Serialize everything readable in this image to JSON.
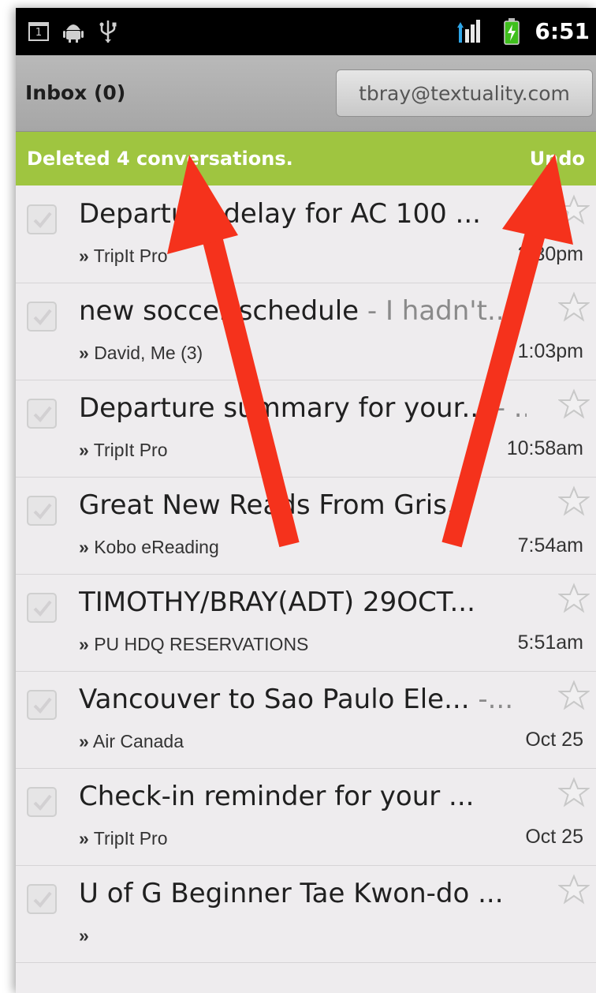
{
  "status_bar": {
    "time": "6:51",
    "calendar_day": "1",
    "icons": [
      "calendar-icon",
      "android-debug-icon",
      "usb-icon",
      "signal-icon",
      "battery-icon"
    ]
  },
  "header": {
    "title": "Inbox (0)",
    "account": "tbray@textuality.com"
  },
  "undo_bar": {
    "message": "Deleted 4 conversations.",
    "undo_label": "Undo",
    "color": "#9fc540"
  },
  "conversations": [
    {
      "subject": "Departure delay for AC 100 ...",
      "snippet": "",
      "sender": "TripIt Pro",
      "time": "3:30pm"
    },
    {
      "subject": "new soccer schedule",
      "snippet": " - I hadn't...",
      "sender": "David, Me (3)",
      "time": "1:03pm"
    },
    {
      "subject": "Departure summary for your...",
      "snippet": " - ...",
      "sender": "TripIt Pro",
      "time": "10:58am"
    },
    {
      "subject": "Great New Reads From Gris...",
      "snippet": "",
      "sender": "Kobo eReading",
      "time": "7:54am"
    },
    {
      "subject": "TIMOTHY/BRAY(ADT) 29OCT...",
      "snippet": "",
      "sender": "PU HDQ RESERVATIONS",
      "time": "5:51am"
    },
    {
      "subject": "Vancouver to Sao Paulo Ele...",
      "snippet": " -...",
      "sender": "Air Canada",
      "time": "Oct 25"
    },
    {
      "subject": "Check-in reminder for your ...",
      "snippet": "",
      "sender": "TripIt Pro",
      "time": "Oct 25"
    },
    {
      "subject": "U of G Beginner Tae Kwon-do ...",
      "snippet": "",
      "sender": "",
      "time": ""
    }
  ],
  "sender_prefix": "»",
  "colors": {
    "arrow": "#f5321c",
    "list_background": "#eeecee",
    "title_bar": "#a6a6a6"
  }
}
